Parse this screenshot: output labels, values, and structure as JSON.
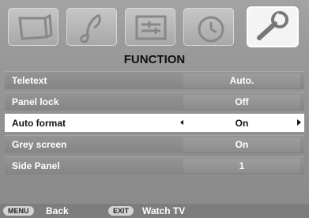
{
  "menu_title": "FUNCTION",
  "tabs": [
    {
      "icon": "tv-picture-icon",
      "active": false
    },
    {
      "icon": "music-note-icon",
      "active": false
    },
    {
      "icon": "settings-sliders-icon",
      "active": false
    },
    {
      "icon": "clock-icon",
      "active": false
    },
    {
      "icon": "wrench-tool-icon",
      "active": true
    }
  ],
  "items": [
    {
      "label": "Teletext",
      "value": "Auto."
    },
    {
      "label": "Panel lock",
      "value": "Off"
    },
    {
      "label": "Auto format",
      "value": "On",
      "selected": true
    },
    {
      "label": "Grey screen",
      "value": "On"
    },
    {
      "label": "Side Panel",
      "value": "1"
    }
  ],
  "footer": {
    "menu_key": "MENU",
    "menu_label": "Back",
    "exit_key": "EXIT",
    "exit_label": "Watch TV"
  }
}
